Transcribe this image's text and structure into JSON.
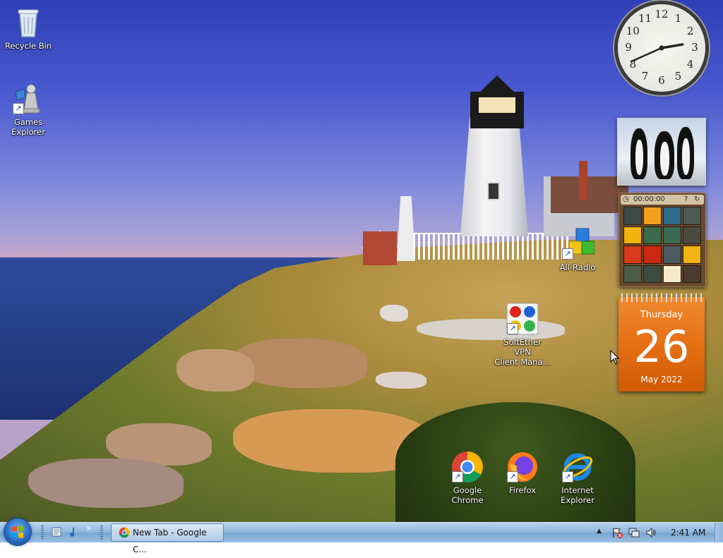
{
  "desktop": {
    "icons": {
      "recycle_bin": "Recycle Bin",
      "games_explorer_l1": "Games",
      "games_explorer_l2": "Explorer",
      "all_radio": "All-Radio",
      "softether_l1": "SoftEther VPN",
      "softether_l2": "Client Mana...",
      "chrome_l1": "Google",
      "chrome_l2": "Chrome",
      "firefox": "Firefox",
      "ie_l1": "Internet",
      "ie_l2": "Explorer"
    }
  },
  "gadgets": {
    "clock": {
      "numerals": [
        "12",
        "1",
        "2",
        "3",
        "4",
        "5",
        "6",
        "7",
        "8",
        "9",
        "10",
        "11"
      ],
      "time_shown": "2:41"
    },
    "puzzle": {
      "timer": "00:00:00",
      "tile_colors": [
        "#3c4a44",
        "#f0a21c",
        "#2f6a8a",
        "#4a5a52",
        "#f1b40d",
        "#3b6b48",
        "#3a6a52",
        "#4a4a40",
        "#d83a1c",
        "#c92a10",
        "#4a5a60",
        "#f2b313",
        "#4b5b45",
        "#3b4b40",
        "#f4e9c8",
        "#4a3a30"
      ]
    },
    "calendar": {
      "weekday": "Thursday",
      "day": "26",
      "month_year": "May 2022"
    }
  },
  "taskbar": {
    "task_label": "New Tab - Google C...",
    "time": "2:41 AM",
    "show_more": "▲",
    "quick_launch_more": "»"
  },
  "colors": {
    "calendar": "#e46d12",
    "taskbar": "#8fb8de",
    "sky": "#4b5ad0"
  }
}
